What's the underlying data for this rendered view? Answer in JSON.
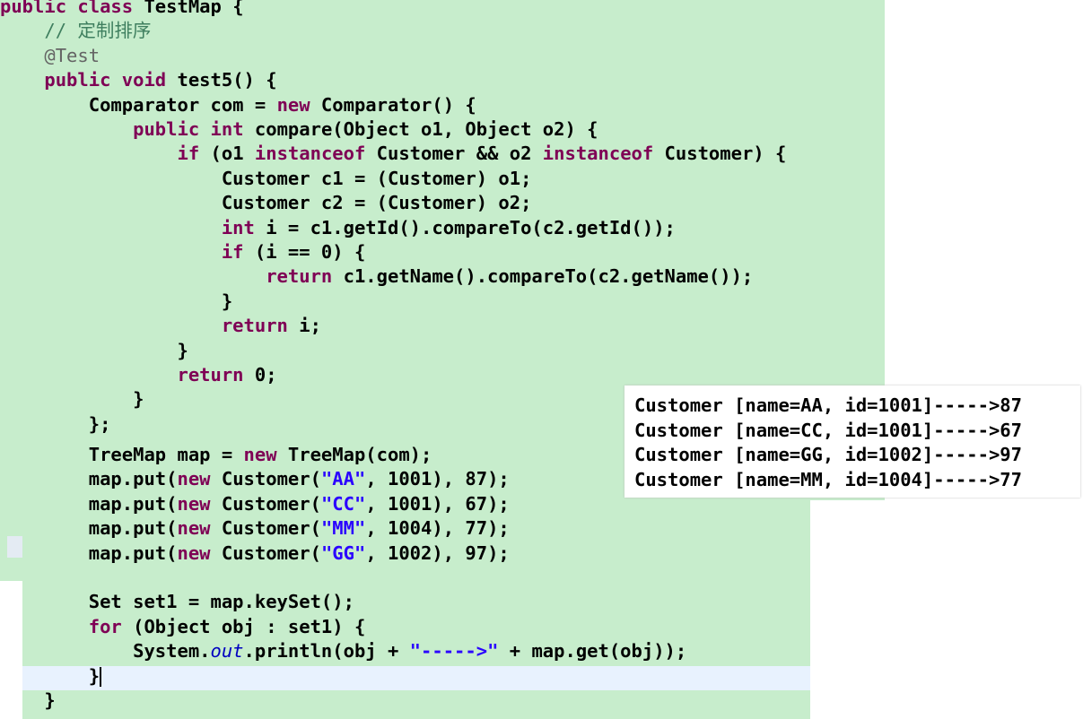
{
  "editor": {
    "lines": [
      {
        "t": [
          [
            "kw",
            "public"
          ],
          [
            "",
            " "
          ],
          [
            "kw",
            "class"
          ],
          [
            "",
            " TestMap {"
          ]
        ]
      },
      {
        "t": [
          [
            "cmt",
            "    // 定制排序"
          ]
        ]
      },
      {
        "t": [
          [
            "ann",
            "    @Test"
          ]
        ]
      },
      {
        "t": [
          [
            "kw",
            "    public"
          ],
          [
            "",
            " "
          ],
          [
            "kw",
            "void"
          ],
          [
            "",
            " test5() {"
          ]
        ]
      },
      {
        "t": [
          [
            "",
            "        Comparator com = "
          ],
          [
            "kw",
            "new"
          ],
          [
            "",
            " Comparator() {"
          ]
        ]
      },
      {
        "t": [
          [
            "kw",
            "            public"
          ],
          [
            "",
            " "
          ],
          [
            "kw",
            "int"
          ],
          [
            "",
            " compare(Object o1, Object o2) {"
          ]
        ]
      },
      {
        "t": [
          [
            "kw",
            "                if"
          ],
          [
            "",
            " (o1 "
          ],
          [
            "kw",
            "instanceof"
          ],
          [
            "",
            " Customer && o2 "
          ],
          [
            "kw",
            "instanceof"
          ],
          [
            "",
            " Customer) {"
          ]
        ]
      },
      {
        "t": [
          [
            "",
            "                    Customer c1 = (Customer) o1;"
          ]
        ]
      },
      {
        "t": [
          [
            "",
            "                    Customer c2 = (Customer) o2;"
          ]
        ]
      },
      {
        "t": [
          [
            "kw",
            "                    int"
          ],
          [
            "",
            " i = c1.getId().compareTo(c2.getId());"
          ]
        ]
      },
      {
        "t": [
          [
            "kw",
            "                    if"
          ],
          [
            "",
            " (i == 0) {"
          ]
        ]
      },
      {
        "t": [
          [
            "kw",
            "                        return"
          ],
          [
            "",
            " c1.getName().compareTo(c2.getName());"
          ]
        ]
      },
      {
        "t": [
          [
            "",
            "                    }"
          ]
        ]
      },
      {
        "t": [
          [
            "kw",
            "                    return"
          ],
          [
            "",
            " i;"
          ]
        ]
      },
      {
        "t": [
          [
            "",
            "                }"
          ]
        ]
      },
      {
        "t": [
          [
            "kw",
            "                return"
          ],
          [
            "",
            " 0;"
          ]
        ]
      },
      {
        "t": [
          [
            "",
            "            }"
          ]
        ]
      },
      {
        "t": [
          [
            "",
            "        };"
          ]
        ]
      }
    ]
  },
  "editor2": {
    "lines": [
      {
        "t": [
          [
            "",
            "        TreeMap map = "
          ],
          [
            "kw",
            "new"
          ],
          [
            "",
            " TreeMap(com);"
          ]
        ]
      },
      {
        "t": [
          [
            "",
            "        map.put("
          ],
          [
            "kw",
            "new"
          ],
          [
            "",
            " Customer("
          ],
          [
            "str",
            "\"AA\""
          ],
          [
            "",
            ", 1001), 87);"
          ]
        ]
      },
      {
        "t": [
          [
            "",
            "        map.put("
          ],
          [
            "kw",
            "new"
          ],
          [
            "",
            " Customer("
          ],
          [
            "str",
            "\"CC\""
          ],
          [
            "",
            ", 1001), 67);"
          ]
        ]
      },
      {
        "t": [
          [
            "",
            "        map.put("
          ],
          [
            "kw",
            "new"
          ],
          [
            "",
            " Customer("
          ],
          [
            "str",
            "\"MM\""
          ],
          [
            "",
            ", 1004), 77);"
          ]
        ]
      },
      {
        "t": [
          [
            "",
            "        map.put("
          ],
          [
            "kw",
            "new"
          ],
          [
            "",
            " Customer("
          ],
          [
            "str",
            "\"GG\""
          ],
          [
            "",
            ", 1002), 97);"
          ]
        ]
      },
      {
        "t": [
          [
            "",
            ""
          ]
        ]
      },
      {
        "t": [
          [
            "",
            "        Set set1 = map.keySet();"
          ]
        ]
      },
      {
        "t": [
          [
            "kw",
            "        for"
          ],
          [
            "",
            " (Object obj : set1) {"
          ]
        ]
      },
      {
        "t": [
          [
            "",
            "            System."
          ],
          [
            "fld",
            "out"
          ],
          [
            "",
            ".println(obj + "
          ],
          [
            "str",
            "\"----->\""
          ],
          [
            "",
            " + map.get(obj));"
          ]
        ]
      },
      {
        "t": [
          [
            "",
            "        }"
          ]
        ]
      },
      {
        "t": [
          [
            "",
            "    }"
          ]
        ]
      }
    ]
  },
  "console": {
    "lines": [
      "Customer [name=AA, id=1001]----->87",
      "Customer [name=CC, id=1001]----->67",
      "Customer [name=GG, id=1002]----->97",
      "Customer [name=MM, id=1004]----->77"
    ]
  }
}
